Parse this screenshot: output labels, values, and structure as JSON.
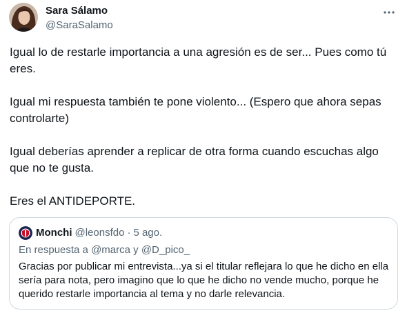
{
  "tweet": {
    "author": {
      "name": "Sara Sálamo",
      "handle": "@SaraSalamo"
    },
    "paragraphs": [
      "Igual lo de restarle importancia a una agresión es de ser... Pues como tú eres.",
      "Igual mi respuesta también te pone violento... (Espero que ahora sepas controlarte)",
      "Igual deberías aprender a replicar de otra forma cuando escuchas algo que no te gusta.",
      "Eres el ANTIDEPORTE."
    ],
    "more_icon": "more-horizontal-icon"
  },
  "quote": {
    "author": {
      "name": "Monchi",
      "handle": "@leonsfdo",
      "separator": "·",
      "date": "5 ago."
    },
    "reply_context": {
      "prefix": "En respuesta a",
      "mention_1": "@marca",
      "joiner": "y",
      "mention_2": "@D_pico_"
    },
    "text": "Gracias por publicar mi entrevista...ya si el titular reflejara lo que he dicho en ella sería para nota, pero imagino que lo que he dicho no vende mucho, porque he querido restarle importancia al tema y no darle relevancia."
  },
  "colors": {
    "text_primary": "#0f1419",
    "text_secondary": "#536471",
    "border": "#cfd9de"
  }
}
